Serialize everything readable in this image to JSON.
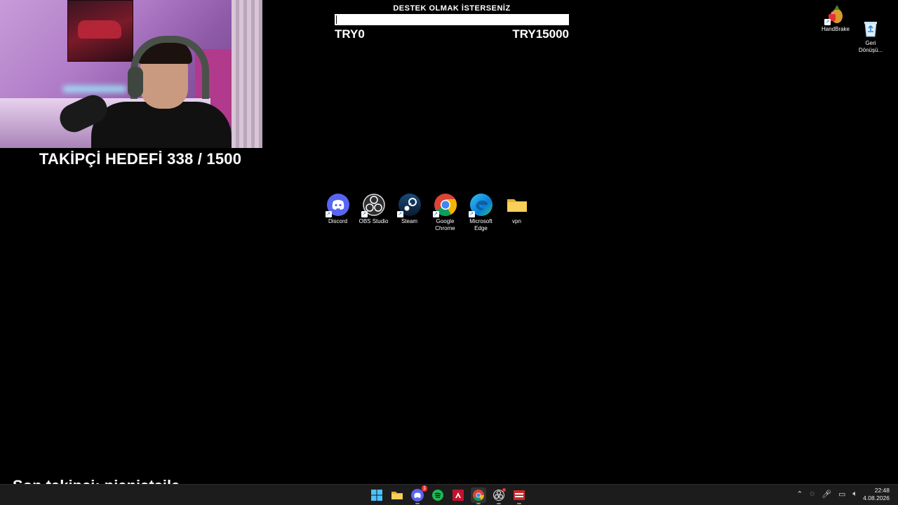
{
  "webcam": {
    "alt": "streamer webcam"
  },
  "follower_goal": {
    "text": "TAKİPÇİ HEDEFİ 338 / 1500",
    "current": 338,
    "goal": 1500
  },
  "donation": {
    "title": "DESTEK OLMAK İSTERSENİZ",
    "min_label": "TRY0",
    "max_label": "TRY15000",
    "progress_fraction": 0.0
  },
  "desktop_icons": [
    {
      "label": "HandBrake",
      "icon": "handbrake-icon"
    },
    {
      "label": "Geri\nDönüşü...",
      "icon": "recycle-bin-icon"
    }
  ],
  "apps": [
    {
      "label": "Discord",
      "icon": "discord-icon",
      "color": "#5865F2"
    },
    {
      "label": "OBS Studio",
      "icon": "obs-icon",
      "color": "#302e31"
    },
    {
      "label": "Steam",
      "icon": "steam-icon",
      "color": "#1b2838"
    },
    {
      "label": "Google Chrome",
      "icon": "chrome-icon",
      "color": "#4285F4"
    },
    {
      "label": "Microsoft Edge",
      "icon": "edge-icon",
      "color": "#0a7cd6"
    },
    {
      "label": "vpn",
      "icon": "folder-icon",
      "color": "#f5c342"
    }
  ],
  "last_follower": {
    "text": "Son takipçi: pianistsila"
  },
  "taskbar": {
    "items": [
      {
        "name": "start",
        "icon": "windows-start-icon"
      },
      {
        "name": "file-explorer",
        "icon": "folder-icon"
      },
      {
        "name": "discord",
        "icon": "discord-icon",
        "badge": "1"
      },
      {
        "name": "spotify",
        "icon": "spotify-icon"
      },
      {
        "name": "amd",
        "icon": "amd-icon"
      },
      {
        "name": "chrome",
        "icon": "chrome-icon"
      },
      {
        "name": "obs",
        "icon": "obs-icon"
      },
      {
        "name": "app",
        "icon": "app-icon"
      }
    ],
    "tray": [
      "chevron-up-icon",
      "network-off-icon",
      "microphone-icon",
      "display-icon",
      "volume-icon"
    ],
    "time": "22:48",
    "date": "4.08.2026"
  }
}
